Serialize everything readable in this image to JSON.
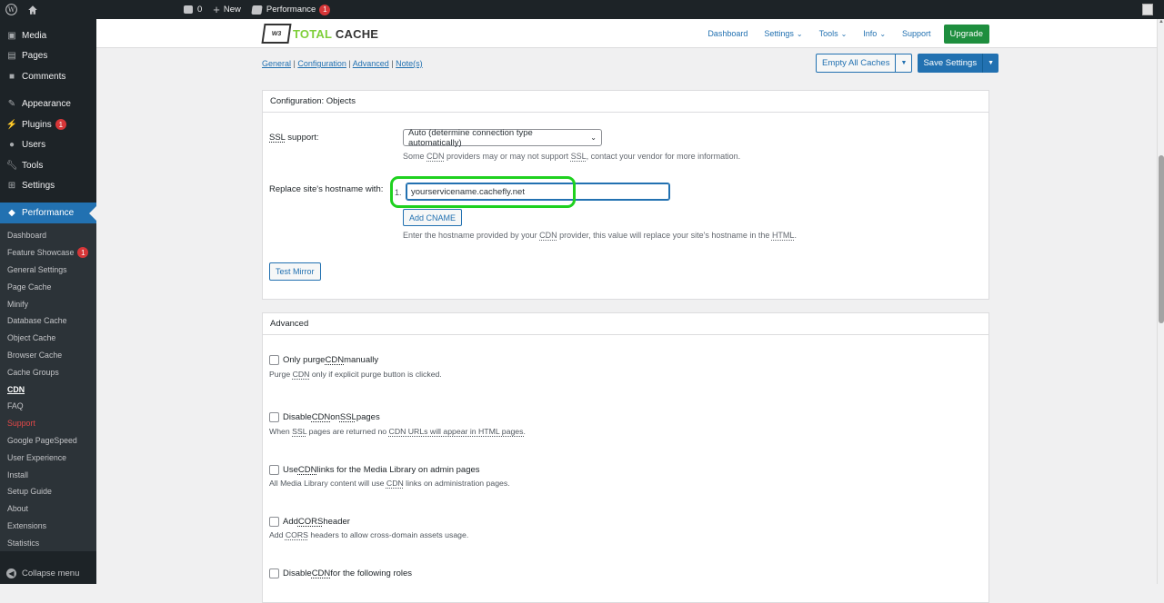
{
  "adminbar": {
    "comments_count": "0",
    "new_label": "New",
    "performance_label": "Performance",
    "performance_badge": "1"
  },
  "sidebar": {
    "items": [
      {
        "label": "Media",
        "icon": "media-icon"
      },
      {
        "label": "Pages",
        "icon": "pages-icon"
      },
      {
        "label": "Comments",
        "icon": "comments-icon"
      },
      {
        "label": "Appearance",
        "icon": "appearance-icon"
      },
      {
        "label": "Plugins",
        "icon": "plugins-icon",
        "badge": "1"
      },
      {
        "label": "Users",
        "icon": "users-icon"
      },
      {
        "label": "Tools",
        "icon": "tools-icon"
      },
      {
        "label": "Settings",
        "icon": "settings-icon"
      },
      {
        "label": "Performance",
        "icon": "performance-icon"
      }
    ],
    "submenu": [
      "Dashboard",
      "Feature Showcase",
      "General Settings",
      "Page Cache",
      "Minify",
      "Database Cache",
      "Object Cache",
      "Browser Cache",
      "Cache Groups",
      "CDN",
      "FAQ",
      "Support",
      "Google PageSpeed",
      "User Experience",
      "Install",
      "Setup Guide",
      "About",
      "Extensions",
      "Statistics"
    ],
    "feature_showcase_badge": "1",
    "collapse_label": "Collapse menu"
  },
  "topnav": {
    "logo_prefix": "TOTAL",
    "logo_suffix": " CACHE",
    "logo_mark": "W3",
    "links": [
      "Dashboard",
      "Settings",
      "Tools",
      "Info",
      "Support"
    ],
    "upgrade": "Upgrade"
  },
  "subnav": {
    "general": "General",
    "configuration": "Configuration",
    "advanced": "Advanced",
    "notes": "Note(s)"
  },
  "actions": {
    "empty_caches": "Empty All Caches",
    "save_settings": "Save Settings"
  },
  "config_panel": {
    "title": "Configuration: Objects",
    "ssl_label_abbr": "SSL",
    "ssl_label_rest": " support:",
    "ssl_value": "Auto (determine connection type automatically)",
    "ssl_desc_1": "Some ",
    "ssl_desc_cdn": "CDN",
    "ssl_desc_2": " providers may or may not support ",
    "ssl_desc_ssl": "SSL",
    "ssl_desc_3": ", contact your vendor for more information.",
    "hostname_label": "Replace site's hostname with:",
    "hostname_index": "1.",
    "hostname_value": "yourservicename.cachefly.net",
    "add_cname": "Add CNAME",
    "hostname_desc_1": "Enter the hostname provided by your ",
    "hostname_desc_cdn": "CDN",
    "hostname_desc_2": " provider, this value will replace your site's hostname in the ",
    "hostname_desc_html": "HTML",
    "hostname_desc_3": ".",
    "test_mirror": "Test Mirror"
  },
  "advanced_panel": {
    "title": "Advanced",
    "options": [
      {
        "pre": "Only purge ",
        "abbr": "CDN",
        "post": " manually",
        "d_pre": "Purge ",
        "d_abbr": "CDN",
        "d_post": " only if explicit purge button is clicked."
      },
      {
        "pre": "Disable ",
        "abbr": "CDN",
        "post": " on ",
        "abbr2": "SSL",
        "post2": " pages",
        "d_pre": "When ",
        "d_abbr": "SSL",
        "d_post": " pages are returned no ",
        "d_abbr2": "CDN URLs will appear in HTML pages.",
        "d_post2": ""
      },
      {
        "pre": "Use ",
        "abbr": "CDN",
        "post": " links for the Media Library on admin pages",
        "d_pre": "All Media Library content will use ",
        "d_abbr": "CDN",
        "d_post": " links on administration pages."
      },
      {
        "pre": "Add ",
        "abbr": "CORS",
        "post": " header",
        "d_pre": "Add ",
        "d_abbr": "CORS",
        "d_post": " headers to allow cross-domain assets usage."
      },
      {
        "pre": "Disable ",
        "abbr": "CDN",
        "post": " for the following roles"
      }
    ]
  }
}
